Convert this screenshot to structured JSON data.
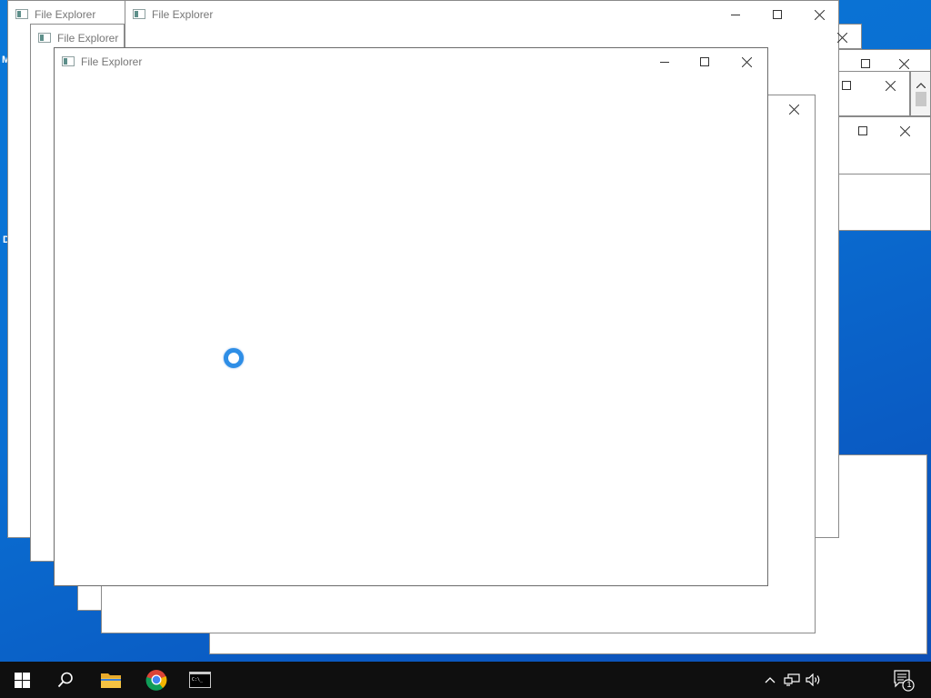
{
  "windows": {
    "back_left": {
      "title": "File Explorer"
    },
    "back_top": {
      "title": "File Explorer"
    },
    "middle": {
      "title": "File Explorer"
    },
    "front": {
      "title": "File Explorer"
    }
  },
  "taskbar": {
    "start": "Start",
    "search": "Search",
    "file_explorer": "File Explorer",
    "chrome": "Google Chrome",
    "terminal": "Command Prompt",
    "terminal_glyph": "C:\\_"
  },
  "tray": {
    "notification_count": "1"
  },
  "colors": {
    "desktop": "#0a6fd2",
    "taskbar": "#0f0f0f",
    "spinner": "#2e8ee6",
    "chrome_red": "#db4437",
    "chrome_yellow": "#f4b400",
    "chrome_green": "#0f9d58",
    "chrome_blue": "#4285f4",
    "folder": "#f5c342"
  },
  "icons": [
    "windows-logo-icon",
    "search-icon",
    "folder-icon",
    "chrome-icon",
    "terminal-icon",
    "chevron-up-icon",
    "network-icon",
    "volume-icon",
    "notification-icon",
    "minimize-icon",
    "maximize-icon",
    "close-icon"
  ]
}
